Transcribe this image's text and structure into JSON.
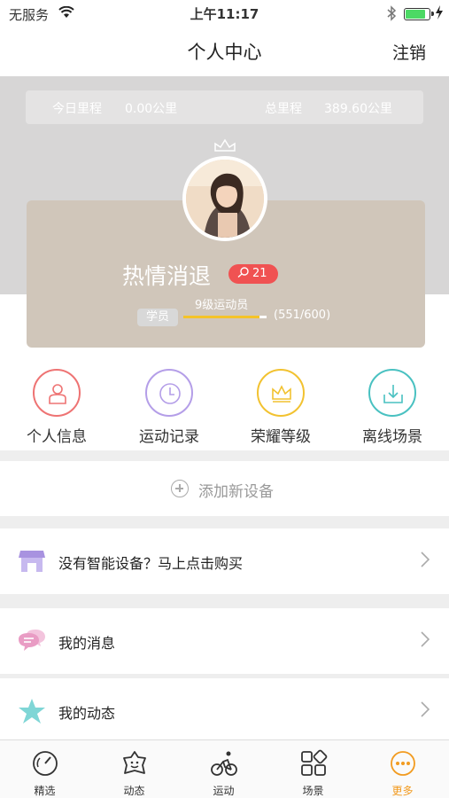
{
  "status_bar": {
    "carrier": "无服务",
    "time": "上午11:17"
  },
  "nav": {
    "title": "个人中心",
    "logout": "注销"
  },
  "mileage": {
    "today_label": "今日里程",
    "today_value": "0.00公里",
    "total_label": "总里程",
    "total_value": "389.60公里"
  },
  "profile": {
    "username": "热情消退",
    "fans_count": "21",
    "role_tag": "学员",
    "level_title": "9级运动员",
    "level_progress_text": "(551/600)",
    "level_progress": 0.918
  },
  "quick_actions": [
    {
      "label": "个人信息",
      "icon": "person-icon",
      "color": "#ee7373"
    },
    {
      "label": "运动记录",
      "icon": "clock-icon",
      "color": "#b49ee8"
    },
    {
      "label": "荣耀等级",
      "icon": "crown-icon",
      "color": "#f2c230"
    },
    {
      "label": "离线场景",
      "icon": "download-icon",
      "color": "#49c1c1"
    }
  ],
  "add_device": {
    "label": "添加新设备"
  },
  "list": [
    {
      "label": "没有智能设备？马上点击购买",
      "icon": "store-icon"
    },
    {
      "label": "我的消息",
      "icon": "message-icon"
    },
    {
      "label": "我的动态",
      "icon": "star-icon"
    }
  ],
  "tabs": [
    {
      "label": "精选",
      "icon": "gauge-icon"
    },
    {
      "label": "动态",
      "icon": "face-icon"
    },
    {
      "label": "运动",
      "icon": "cyclist-icon"
    },
    {
      "label": "场景",
      "icon": "grid-icon"
    },
    {
      "label": "更多",
      "icon": "more-icon",
      "active": true
    }
  ],
  "colors": {
    "accent": "#f29b20",
    "card": "#d0c6ba",
    "badge": "#f05252",
    "level_fill": "#f5c328"
  }
}
